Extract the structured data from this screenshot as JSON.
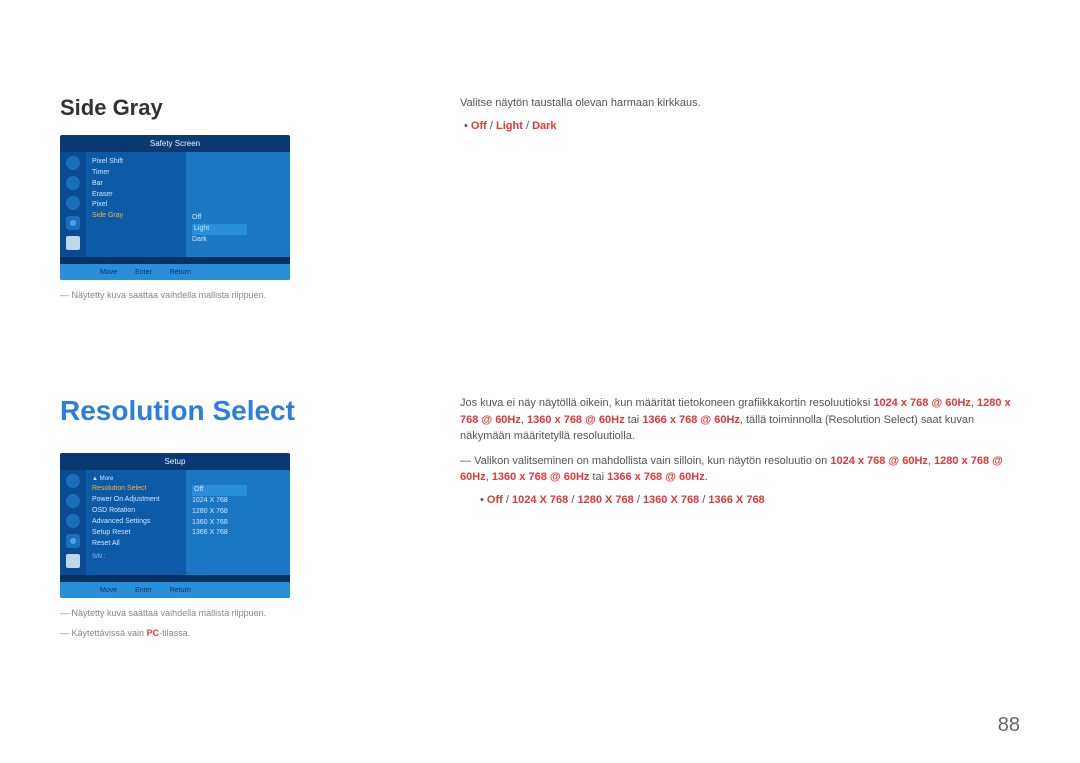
{
  "page_number": "88",
  "sec1": {
    "heading": "Side Gray",
    "desc": "Valitse näytön taustalla olevan harmaan kirkkaus.",
    "options": [
      "Off",
      "Light",
      "Dark"
    ],
    "caption": "Näytetty kuva saattaa vaihdella mallista riippuen.",
    "osd": {
      "title": "Safety Screen",
      "menu": [
        "Pixel Shift",
        "Timer",
        "Bar",
        "Eraser",
        "Pixel",
        "Side Gray"
      ],
      "highlight": "Side Gray",
      "values": [
        "Off",
        "Light",
        "Dark"
      ],
      "selected": "Light",
      "footer": [
        "Move",
        "Enter",
        "Return"
      ]
    }
  },
  "sec2": {
    "heading": "Resolution Select",
    "para1_a": "Jos kuva ei näy näytöllä oikein, kun määrität tietokoneen grafiikkakortin resoluutioksi ",
    "res_list": [
      "1024 x 768 @ 60Hz",
      "1280 x 768 @ 60Hz",
      "1360 x 768 @ 60Hz"
    ],
    "tai1": " tai ",
    "res_last": "1366 x 768 @ 60Hz",
    "para1_b": ", tällä toiminnolla (Resolution Select) saat kuvan näkymään määritetyllä resoluutiolla.",
    "note_a": "Valikon valitseminen on mahdollista vain silloin, kun näytön resoluutio on ",
    "note_list": [
      "1024 x 768 @ 60Hz",
      "1280 x 768 @ 60Hz",
      "1360 x 768 @ 60Hz"
    ],
    "tai2": " tai ",
    "note_last": "1366 x 768 @ 60Hz",
    "options": [
      "Off",
      "1024 X 768",
      "1280 X 768",
      "1360 X 768",
      "1366 X 768"
    ],
    "caption1": "Näytetty kuva saattaa vaihdella mallista riippuen.",
    "caption2_a": "Käytettävissä vain ",
    "caption2_b": "PC",
    "caption2_c": "-tilassa.",
    "osd": {
      "title": "Setup",
      "more": "More",
      "menu": [
        "Resolution Select",
        "Power On Adjustment",
        "OSD Rotation",
        "Advanced Settings",
        "Setup Reset",
        "Reset All"
      ],
      "highlight": "Resolution Select",
      "sn": "S/N : ",
      "values": [
        "Off",
        "1024 X 768",
        "1280 X 768",
        "1360 X 768",
        "1366 X 768"
      ],
      "selected": "Off",
      "footer": [
        "Move",
        "Enter",
        "Return"
      ]
    }
  }
}
